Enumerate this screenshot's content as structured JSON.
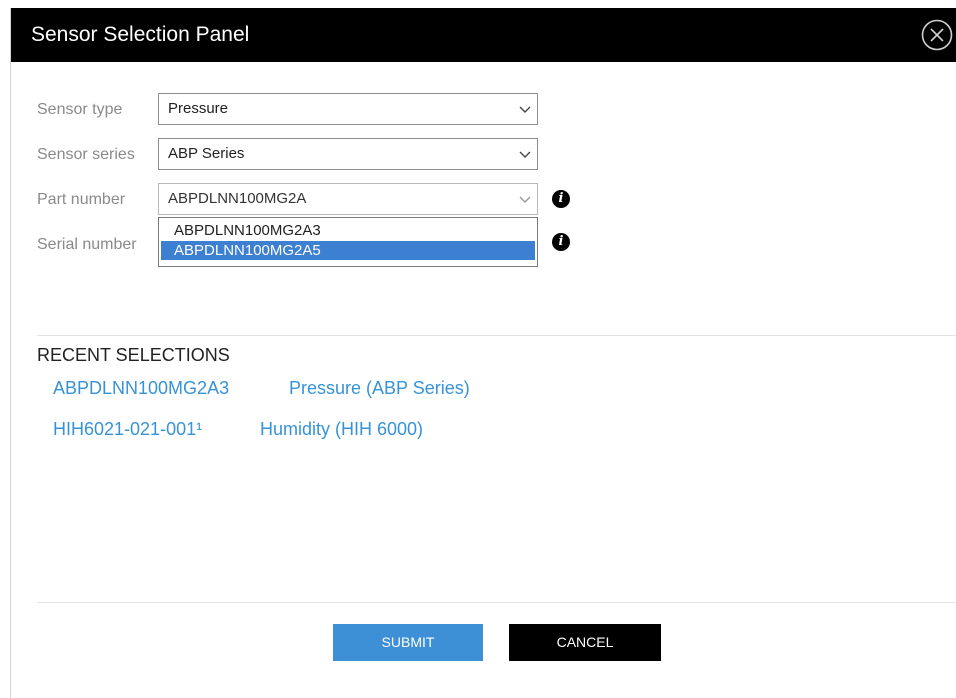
{
  "window": {
    "title": "Sensor Selection Panel"
  },
  "icons": {
    "close": "close-circle-icon",
    "info": "info-icon",
    "caret": "chevron-down-icon"
  },
  "form": {
    "sensor_type": {
      "label": "Sensor type",
      "value": "Pressure"
    },
    "sensor_series": {
      "label": "Sensor series",
      "value": "ABP Series"
    },
    "part_number": {
      "label": "Part number",
      "value": "ABPDLNN100MG2A",
      "options": [
        "ABPDLNN100MG2A3",
        "ABPDLNN100MG2A5"
      ],
      "highlighted_option": "ABPDLNN100MG2A5",
      "info_glyph": "i"
    },
    "serial_number": {
      "label": "Serial number",
      "info_glyph": "i"
    }
  },
  "recent": {
    "heading": "RECENT SELECTIONS",
    "items": [
      {
        "part": "ABPDLNN100MG2A3",
        "category": "Pressure (ABP Series)"
      },
      {
        "part": "HIH6021-021-001¹",
        "category": "Humidity (HIH 6000)"
      }
    ]
  },
  "buttons": {
    "submit": "SUBMIT",
    "cancel": "CANCEL"
  },
  "colors": {
    "titlebar": "#000000",
    "link": "#3793d8",
    "submit": "#3d8fd6",
    "cancel": "#000000",
    "highlight": "#3d7fd1"
  }
}
